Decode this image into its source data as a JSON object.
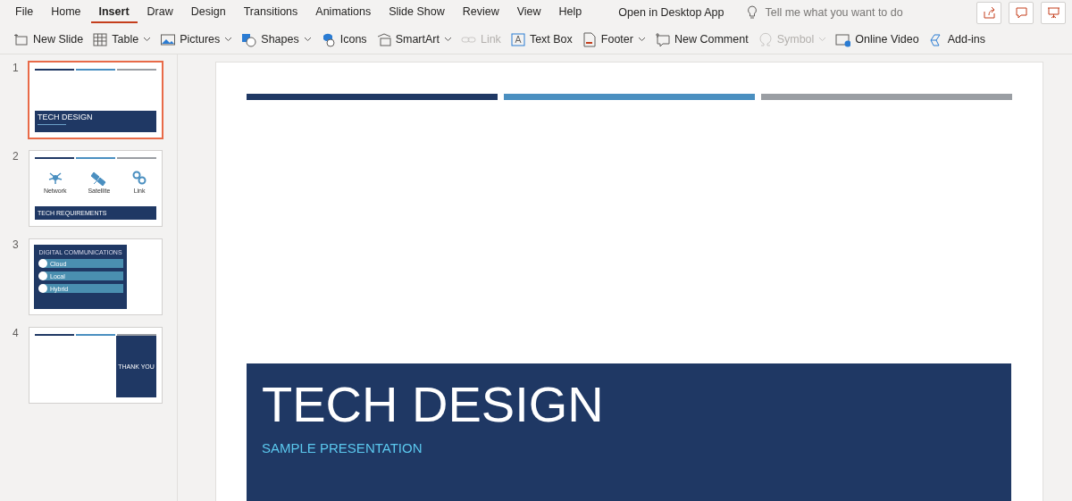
{
  "menu_tabs": [
    {
      "label": "File",
      "selected": false
    },
    {
      "label": "Home",
      "selected": false
    },
    {
      "label": "Insert",
      "selected": true
    },
    {
      "label": "Draw",
      "selected": false
    },
    {
      "label": "Design",
      "selected": false
    },
    {
      "label": "Transitions",
      "selected": false
    },
    {
      "label": "Animations",
      "selected": false
    },
    {
      "label": "Slide Show",
      "selected": false
    },
    {
      "label": "Review",
      "selected": false
    },
    {
      "label": "View",
      "selected": false
    },
    {
      "label": "Help",
      "selected": false
    }
  ],
  "open_desktop": "Open in Desktop App",
  "search": {
    "placeholder": "Tell me what you want to do"
  },
  "ribbon": [
    {
      "label": "New Slide",
      "dropdown": false,
      "disabled": false
    },
    {
      "label": "Table",
      "dropdown": true,
      "disabled": false
    },
    {
      "label": "Pictures",
      "dropdown": true,
      "disabled": false
    },
    {
      "label": "Shapes",
      "dropdown": true,
      "disabled": false
    },
    {
      "label": "Icons",
      "dropdown": false,
      "disabled": false
    },
    {
      "label": "SmartArt",
      "dropdown": true,
      "disabled": false
    },
    {
      "label": "Link",
      "dropdown": false,
      "disabled": true
    },
    {
      "label": "Text Box",
      "dropdown": false,
      "disabled": false
    },
    {
      "label": "Footer",
      "dropdown": true,
      "disabled": false
    },
    {
      "label": "New Comment",
      "dropdown": false,
      "disabled": false
    },
    {
      "label": "Symbol",
      "dropdown": true,
      "disabled": true
    },
    {
      "label": "Online Video",
      "dropdown": false,
      "disabled": false
    },
    {
      "label": "Add-ins",
      "dropdown": false,
      "disabled": false
    }
  ],
  "slides": [
    {
      "number": "1",
      "selected": true,
      "kind": "title",
      "texts": [
        "TECH DESIGN"
      ]
    },
    {
      "number": "2",
      "selected": false,
      "kind": "icons",
      "texts": [
        "Network",
        "Satellite",
        "Link",
        "TECH REQUIREMENTS"
      ]
    },
    {
      "number": "3",
      "selected": false,
      "kind": "list",
      "texts": [
        "DIGITAL COMMUNICATIONS",
        "Cloud",
        "Local",
        "Hybrid"
      ]
    },
    {
      "number": "4",
      "selected": false,
      "kind": "closing",
      "texts": [
        "THANK YOU"
      ]
    }
  ],
  "current_slide": {
    "title": "TECH DESIGN",
    "subtitle": "SAMPLE PRESENTATION"
  }
}
